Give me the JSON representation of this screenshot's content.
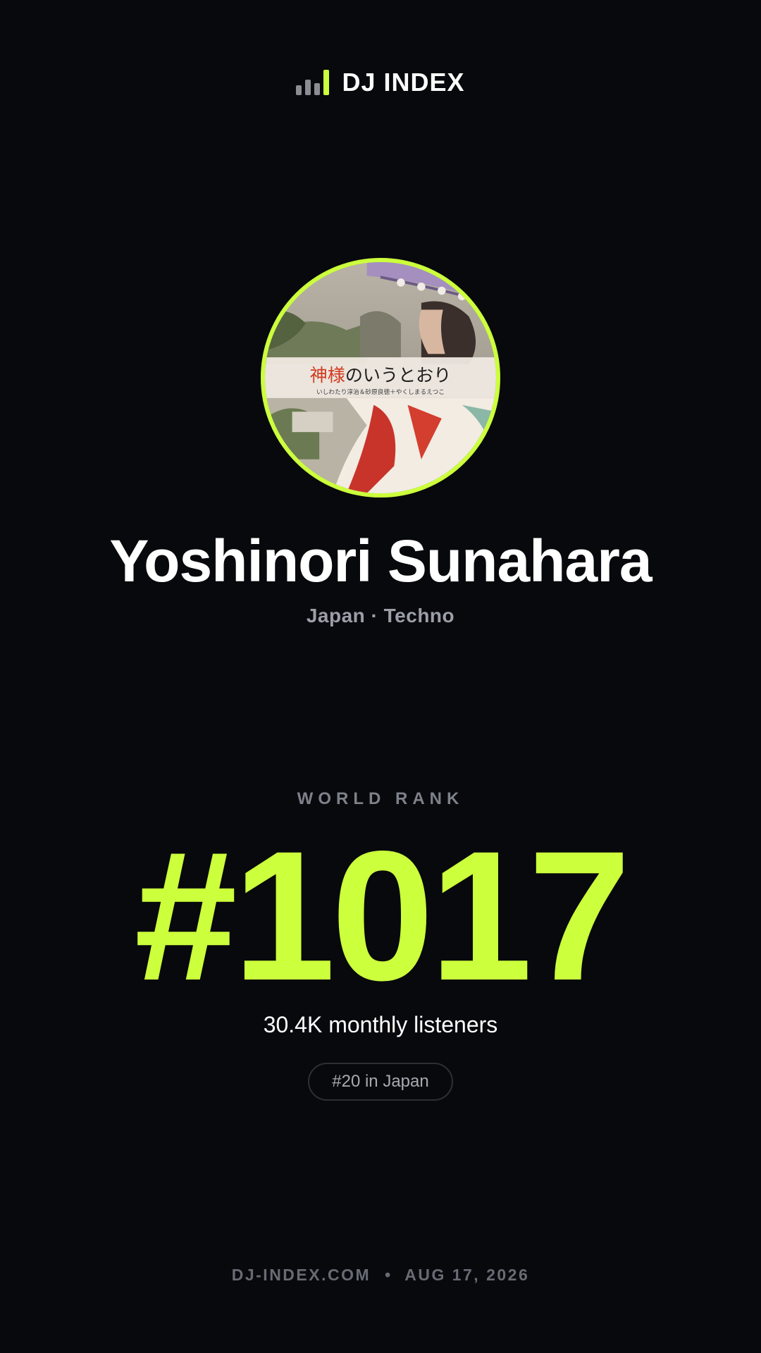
{
  "brand": {
    "name": "DJ INDEX",
    "logo_icon": "equalizer-bars-icon",
    "accent": "#ccff3c"
  },
  "artist": {
    "name": "Yoshinori Sunahara",
    "meta": "Japan · Techno",
    "avatar": {
      "icon": "artist-avatar-image",
      "title_jp": "神様のいうとおり",
      "subtitle_jp": "いしわたり淳治＆砂原良徳＋やくしまるえつこ"
    }
  },
  "rank": {
    "label": "WORLD RANK",
    "value": "#1017",
    "listeners": "30.4K monthly listeners",
    "country_rank": "#20 in Japan"
  },
  "footer": {
    "site": "DJ-INDEX.COM",
    "separator": "•",
    "date": "AUG 17, 2026"
  }
}
